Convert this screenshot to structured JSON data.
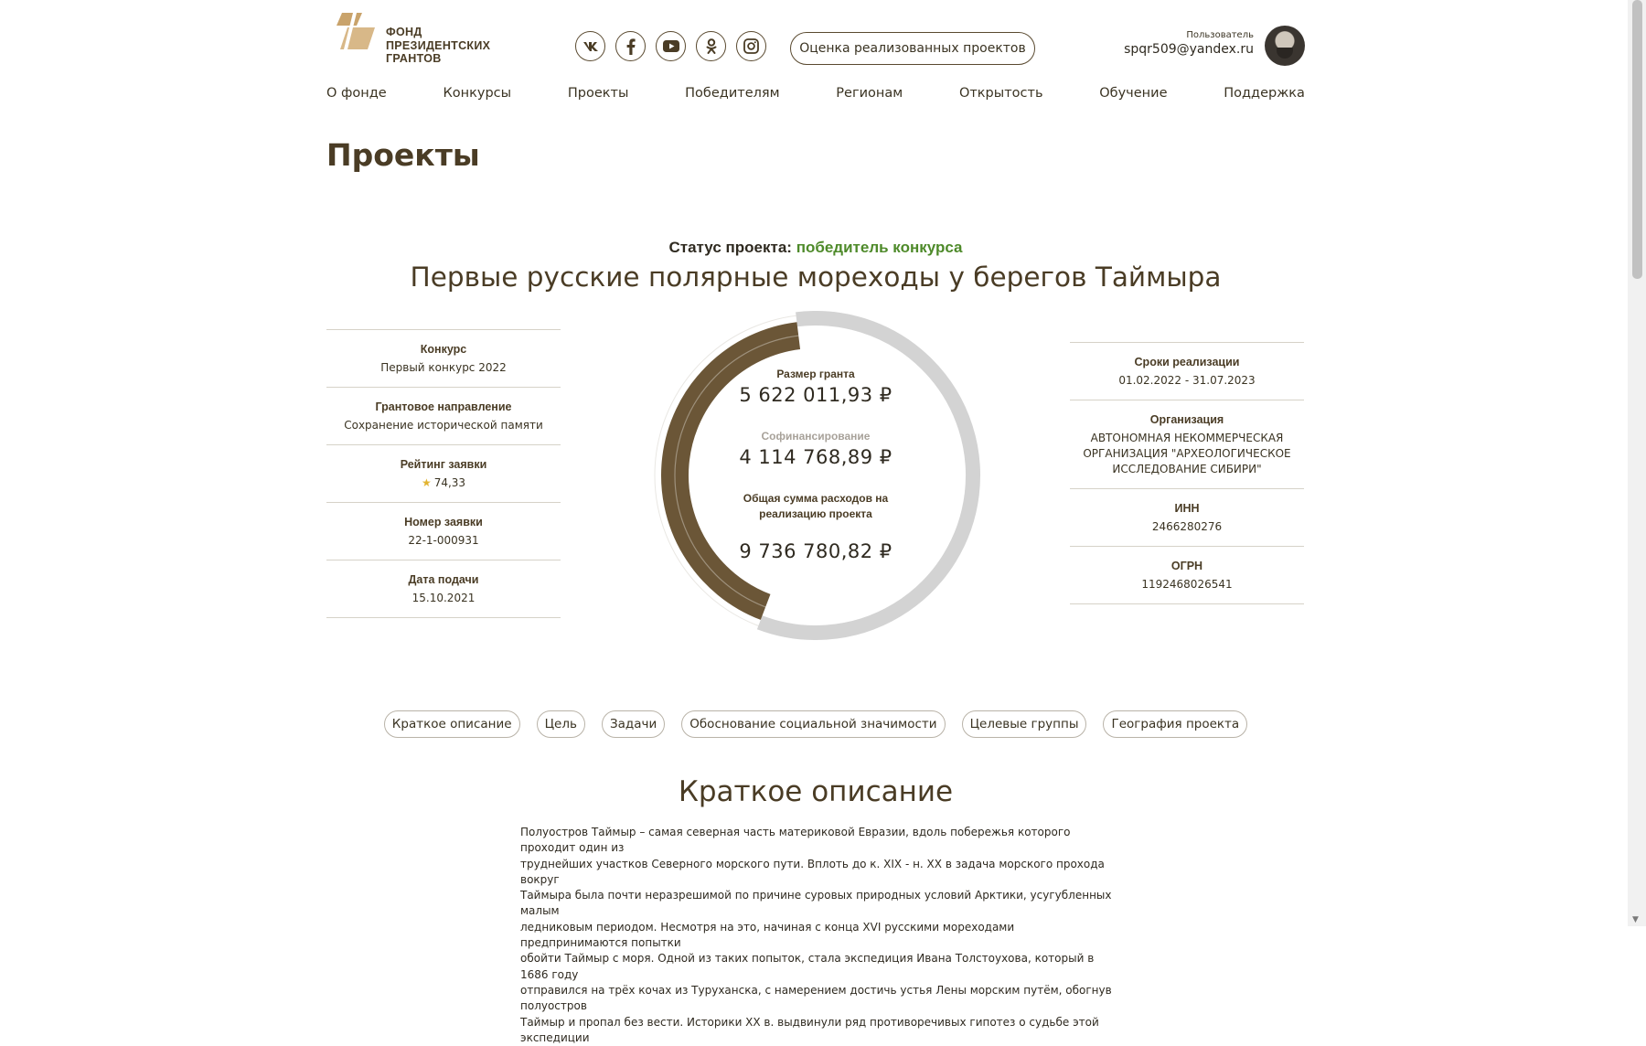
{
  "brand": {
    "logo_text_line1": "ФОНД",
    "logo_text_line2": "ПРЕЗИДЕНТСКИХ",
    "logo_text_line3": "ГРАНТОВ",
    "color": "#c9a36b"
  },
  "socials": [
    {
      "icon": "vk-icon"
    },
    {
      "icon": "facebook-icon"
    },
    {
      "icon": "youtube-icon"
    },
    {
      "icon": "odnoklassniki-icon"
    },
    {
      "icon": "instagram-icon"
    }
  ],
  "header": {
    "eval_button": "Оценка реализованных проектов",
    "user_label": "Пользователь",
    "user_email": "spqr509@yandex.ru"
  },
  "nav": [
    "О фонде",
    "Конкурсы",
    "Проекты",
    "Победителям",
    "Регионам",
    "Открытость",
    "Обучение",
    "Поддержка"
  ],
  "page_title": "Проекты",
  "project": {
    "status_label": "Статус проекта:",
    "status_value": "победитель конкурса",
    "title": "Первые русские полярные мореходы у берегов Таймыра"
  },
  "left_info": [
    {
      "label": "Конкурс",
      "value": "Первый конкурс 2022"
    },
    {
      "label": "Грантовое направление",
      "value": "Сохранение исторической памяти"
    },
    {
      "label": "Рейтинг заявки",
      "value": "74,33"
    },
    {
      "label": "Номер заявки",
      "value": "22-1-000931"
    },
    {
      "label": "Дата подачи",
      "value": "15.10.2021"
    }
  ],
  "right_info": [
    {
      "label": "Сроки реализации",
      "value": "01.02.2022 - 31.07.2023"
    },
    {
      "label": "Организация",
      "value": "АВТОНОМНАЯ НЕКОММЕРЧЕСКАЯ ОРГАНИЗАЦИЯ \"АРХЕОЛОГИЧЕСКОЕ ИССЛЕДОВАНИЕ СИБИРИ\""
    },
    {
      "label": "ИНН",
      "value": "2466280276"
    },
    {
      "label": "ОГРН",
      "value": "1192468026541"
    }
  ],
  "finance": {
    "grant_label": "Размер гранта",
    "grant_value": "5 622 011,93 ₽",
    "cofinancing_label": "Софинансирование",
    "cofinancing_value": "4 114 768,89 ₽",
    "total_label_line1": "Общая сумма расходов на",
    "total_label_line2": "реализацию проекта",
    "total_value": "9 736 780,82 ₽",
    "grant_amount": 5622011.93,
    "cofinancing_amount": 4114768.89,
    "total_amount": 9736780.82,
    "grant_color": "#6b5637",
    "cofinancing_color": "#d3d3d3"
  },
  "tabs": [
    "Краткое описание",
    "Цель",
    "Задачи",
    "Обоснование социальной значимости",
    "Целевые группы",
    "География проекта"
  ],
  "section": {
    "title": "Краткое описание",
    "lines": [
      "Полуостров Таймыр – самая северная часть материковой Евразии, вдоль побережья которого проходит один из",
      "труднейших участков Северного морского пути. Вплоть до к. XIX - н. XX в задача морского прохода вокруг",
      "Таймыра была почти неразрешимой по причине суровых природных условий Арктики, усугубленных малым",
      "ледниковым периодом. Несмотря на это, начиная с конца XVI русскими мореходами предпринимаются попытки",
      "обойти Таймыр с моря. Одной из таких попыток, стала экспедиция Ивана Толстоухова, который в 1686 году",
      "отправился на трёх кочах из Туруханска, с намерением достичь устья Лены морским путём, обогнув полуостров",
      "Таймыр и пропал без вести. Историки XX в. выдвинули ряд противоречивых гипотез о судьбе этой экспедиции"
    ]
  }
}
